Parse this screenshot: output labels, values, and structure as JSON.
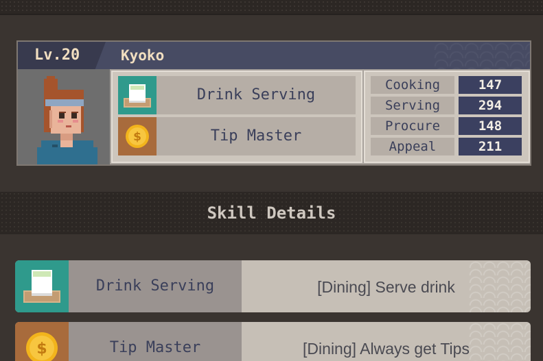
{
  "character": {
    "level": "Lv.20",
    "name": "Kyoko",
    "skills": [
      {
        "label": "Drink Serving",
        "icon": "tea-cup-icon",
        "icon_bg": "#2f9a8c"
      },
      {
        "label": "Tip Master",
        "icon": "gold-coin-icon",
        "icon_bg": "#a86b3c"
      }
    ],
    "stats": [
      {
        "name": "Cooking",
        "value": "147"
      },
      {
        "name": "Serving",
        "value": "294"
      },
      {
        "name": "Procure",
        "value": "148"
      },
      {
        "name": "Appeal",
        "value": "211"
      }
    ]
  },
  "section": {
    "title": "Skill Details"
  },
  "skill_details": [
    {
      "name": "Drink Serving",
      "description": "[Dining] Serve drink",
      "icon": "tea-cup-icon"
    },
    {
      "name": "Tip Master",
      "description": "[Dining] Always get Tips",
      "icon": "gold-coin-icon"
    }
  ],
  "colors": {
    "header_bg": "#474b63",
    "stat_value_bg": "#3b4060",
    "teal_icon_bg": "#2f9a8c",
    "copper_icon_bg": "#a86b3c",
    "background": "#3a3430"
  }
}
